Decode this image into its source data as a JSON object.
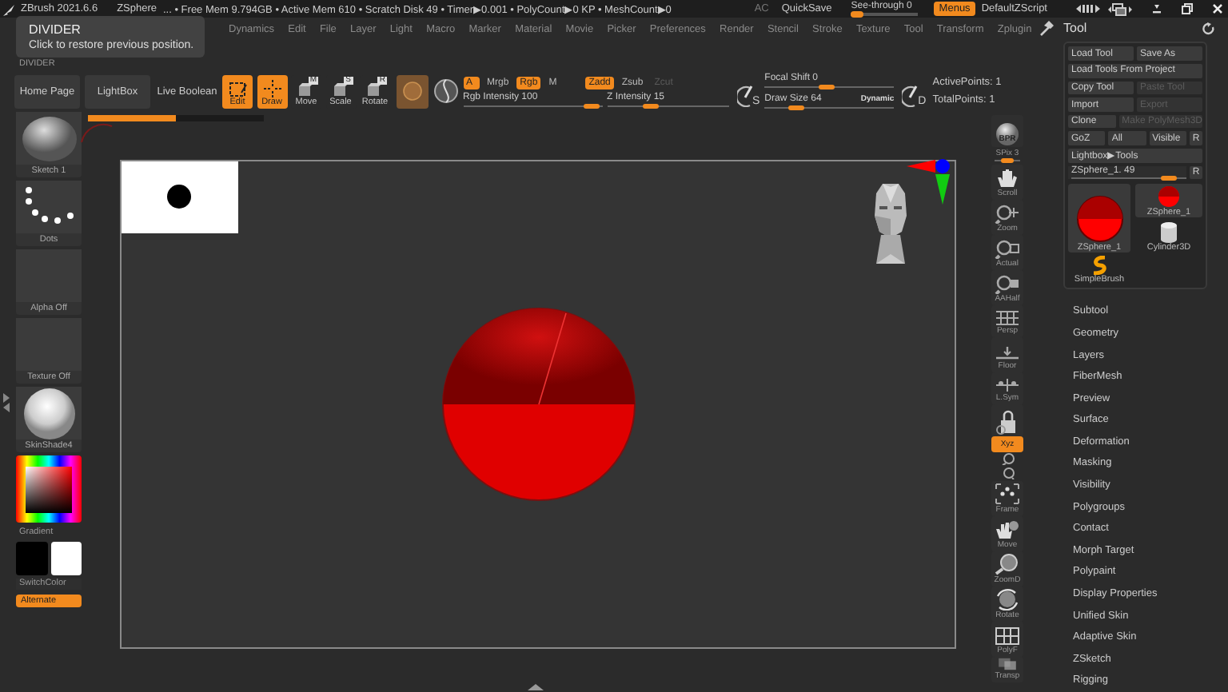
{
  "title_bar": {
    "app": "ZBrush 2021.6.6",
    "document": "ZSphere",
    "stats": "... • Free Mem 9.794GB • Active Mem 610 • Scratch Disk 49 • Timer▶0.001 • PolyCount▶0 KP • MeshCount▶0",
    "ac": "AC",
    "quicksave": "QuickSave",
    "see_through": {
      "label": "See-through  0",
      "level": 0.0
    },
    "menus": {
      "label": "Menus",
      "on": true
    },
    "script": "DefaultZScript"
  },
  "menu_bar": [
    "Dynamics",
    "Edit",
    "File",
    "Layer",
    "Light",
    "Macro",
    "Marker",
    "Material",
    "Movie",
    "Picker",
    "Preferences",
    "Render",
    "Stencil",
    "Stroke",
    "Texture",
    "Tool",
    "Transform",
    "Zplugin"
  ],
  "tooltip": {
    "title": "DIVIDER",
    "text": "Click to restore previous position."
  },
  "divider_label": "DIVIDER",
  "toolbar": {
    "buttons": [
      {
        "label": "Home Page",
        "kind": "button"
      },
      {
        "label": "LightBox",
        "kind": "button"
      },
      {
        "label": "Live Boolean",
        "kind": "toggle"
      }
    ],
    "modes": [
      {
        "label": "Edit",
        "kind": "edit",
        "on": true
      },
      {
        "label": "Draw",
        "kind": "draw",
        "on": true
      },
      {
        "label": "Move",
        "kind": "move",
        "on": false,
        "badge": "M"
      },
      {
        "label": "Scale",
        "kind": "scale",
        "on": false,
        "badge": "S"
      },
      {
        "label": "Rotate",
        "kind": "rotate",
        "on": false,
        "badge": "R"
      }
    ],
    "color_modes": [
      {
        "label": "A",
        "on": true
      },
      {
        "label": "Mrgb",
        "on": false
      },
      {
        "label": "Rgb",
        "on": true
      },
      {
        "label": "M",
        "on": false
      }
    ],
    "depth_modes": [
      {
        "label": "Zadd",
        "on": true,
        "disabled": false
      },
      {
        "label": "Zsub",
        "on": false,
        "disabled": false
      },
      {
        "label": "Zcut",
        "on": false,
        "disabled": true
      }
    ],
    "sliders": [
      {
        "label": "Rgb Intensity 100",
        "level": 0.92
      },
      {
        "label": "Z Intensity 15",
        "level": 0.36
      }
    ],
    "brush_buttons": [
      {
        "letter": "S"
      },
      {
        "letter": "D"
      }
    ],
    "brush_sliders": [
      {
        "label": "Focal Shift 0",
        "level": 0.48
      },
      {
        "label": "Draw Size 64",
        "level": 0.25
      }
    ],
    "dynamic": "Dynamic",
    "points": [
      "ActivePoints: 1",
      "TotalPoints: 1"
    ]
  },
  "progress": {
    "level": 0.5
  },
  "left_shelf": {
    "tiles": [
      {
        "label": "Sketch 1",
        "kind": "brush"
      },
      {
        "label": "Dots",
        "kind": "stroke"
      },
      {
        "label": "Alpha Off",
        "kind": "empty"
      },
      {
        "label": "Texture Off",
        "kind": "empty"
      },
      {
        "label": "SkinShade4",
        "kind": "material"
      }
    ],
    "gradient_label": "Gradient",
    "swatches": [
      {
        "color": "#000000"
      },
      {
        "color": "#ffffff"
      }
    ],
    "switch_label": "SwitchColor",
    "alternate": {
      "label": "Alternate",
      "on": true
    }
  },
  "right_shelf": [
    {
      "kind": "bpr",
      "label": "BPR",
      "on": false
    },
    {
      "kind": "spix",
      "label": "SPix 3",
      "level": 0.5,
      "on": false
    },
    {
      "kind": "scroll",
      "label": "Scroll",
      "on": false
    },
    {
      "kind": "zoom",
      "label": "Zoom",
      "on": false
    },
    {
      "kind": "actual",
      "label": "Actual",
      "on": false
    },
    {
      "kind": "aahalf",
      "label": "AAHalf",
      "on": false
    },
    {
      "kind": "persp",
      "label": "Persp",
      "on": false
    },
    {
      "kind": "floor",
      "label": "Floor",
      "on": false
    },
    {
      "kind": "lsym",
      "label": "L.Sym",
      "on": false
    },
    {
      "kind": "lock",
      "on": false
    },
    {
      "kind": "xyz",
      "label": "Xyz",
      "on": true
    },
    {
      "kind": "rot_y",
      "on": false
    },
    {
      "kind": "rot_z",
      "on": false
    },
    {
      "kind": "frame",
      "label": "Frame",
      "on": false
    },
    {
      "kind": "move",
      "label": "Move",
      "on": false
    },
    {
      "kind": "zoomd",
      "label": "ZoomD",
      "on": false
    },
    {
      "kind": "rotate",
      "label": "Rotate",
      "on": false
    },
    {
      "kind": "polyf",
      "label": "PolyF",
      "on": false
    },
    {
      "kind": "transp",
      "label": "Transp",
      "on": false
    }
  ],
  "tool_panel": {
    "title": "Tool",
    "button_rows": [
      [
        {
          "label": "Load Tool",
          "disabled": false
        },
        {
          "label": "Save As",
          "disabled": false
        }
      ],
      [
        {
          "label": "Load Tools From Project",
          "disabled": false
        }
      ],
      [
        {
          "label": "Copy Tool",
          "disabled": false
        },
        {
          "label": "Paste Tool",
          "disabled": true
        }
      ],
      [
        {
          "label": "Import",
          "disabled": false
        },
        {
          "label": "Export",
          "disabled": true
        }
      ],
      [
        {
          "label": "Clone",
          "disabled": false
        },
        {
          "label": "Make PolyMesh3D",
          "disabled": true
        }
      ],
      [
        {
          "label": "GoZ",
          "disabled": false
        },
        {
          "label": "All",
          "disabled": false
        },
        {
          "label": "Visible",
          "disabled": false
        },
        {
          "label": "R",
          "disabled": false
        }
      ],
      [
        {
          "label": "Lightbox▶Tools",
          "disabled": false
        }
      ]
    ],
    "slider": {
      "label": "ZSphere_1. 49",
      "level": 0.85
    },
    "slider_button": "R",
    "tools": [
      {
        "label": "ZSphere_1",
        "kind": "zsphere"
      },
      {
        "label": "ZSphere_1",
        "kind": "zsphere_large"
      },
      {
        "label": "Cylinder3D",
        "kind": "cylinder"
      },
      {
        "label": "SimpleBrush",
        "kind": "brush"
      }
    ],
    "subpalettes": [
      "Subtool",
      "Geometry",
      "Layers",
      "FiberMesh",
      "Preview",
      "Surface",
      "Deformation",
      "Masking",
      "Visibility",
      "Polygroups",
      "Contact",
      "Morph Target",
      "Polypaint",
      "Display Properties",
      "Unified Skin",
      "Adaptive Skin",
      "ZSketch",
      "Rigging"
    ]
  }
}
